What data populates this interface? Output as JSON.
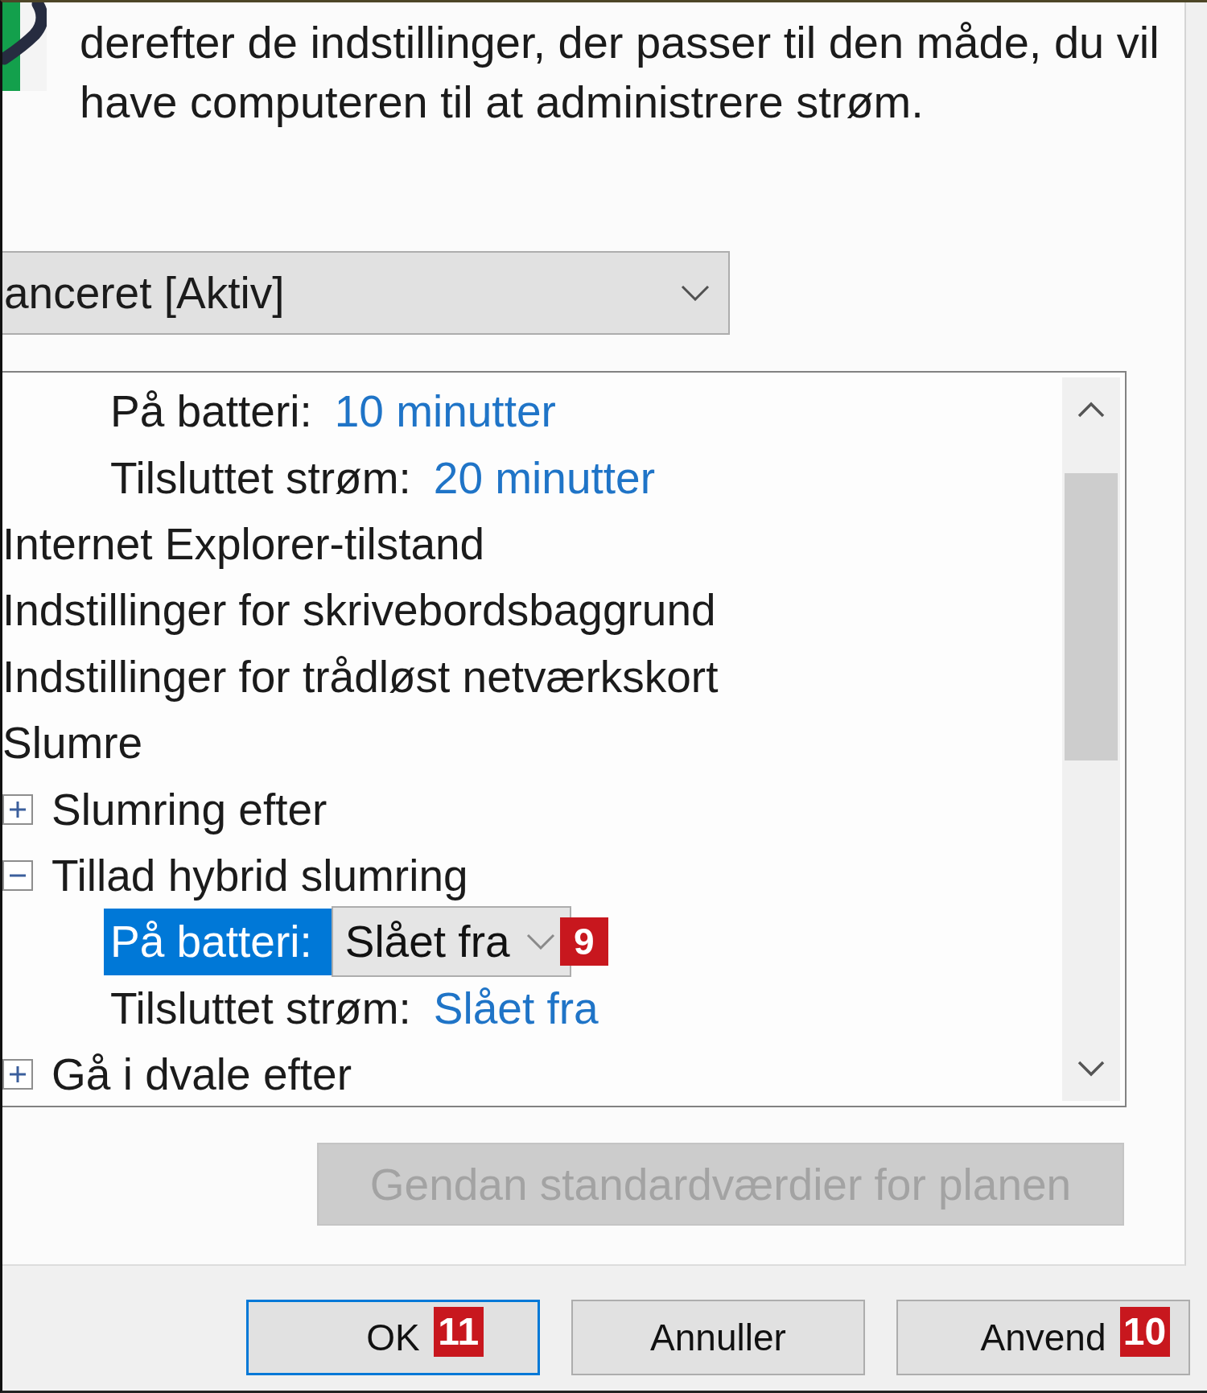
{
  "header": {
    "description": "derefter de indstillinger, der passer til den måde, du vil have computeren til at administrere strøm."
  },
  "plan_select": {
    "value": "anceret [Aktiv]"
  },
  "tree": {
    "items": [
      {
        "kind": "setting",
        "label": "På batteri:",
        "value": "10 minutter",
        "selected": false
      },
      {
        "kind": "setting",
        "label": "Tilsluttet strøm:",
        "value": "20 minutter",
        "selected": false
      },
      {
        "kind": "category",
        "label": "Internet Explorer-tilstand",
        "selected": false
      },
      {
        "kind": "category",
        "label": "Indstillinger for skrivebordsbaggrund",
        "selected": false
      },
      {
        "kind": "category",
        "label": "Indstillinger for trådløst netværkskort",
        "selected": false
      },
      {
        "kind": "category",
        "label": "Slumre",
        "selected": false,
        "children": [
          {
            "kind": "group",
            "label": "Slumring efter",
            "expanded": false,
            "selected": false
          },
          {
            "kind": "group",
            "label": "Tillad hybrid slumring",
            "expanded": true,
            "selected": false,
            "children": [
              {
                "kind": "setting",
                "label": "På batteri:",
                "value": "Slået fra",
                "selected": true,
                "marker": "9"
              },
              {
                "kind": "setting",
                "label": "Tilsluttet strøm:",
                "value": "Slået fra",
                "selected": false
              }
            ]
          },
          {
            "kind": "group",
            "label": "Gå i dvale efter",
            "expanded": false,
            "selected": false
          }
        ]
      }
    ]
  },
  "restore_button": {
    "label": "Gendan standardværdier for planen",
    "disabled": true
  },
  "buttons": [
    {
      "label": "OK",
      "default": true,
      "marker": "11"
    },
    {
      "label": "Annuller",
      "default": false
    },
    {
      "label": "Anvend",
      "default": false,
      "marker": "10"
    }
  ]
}
